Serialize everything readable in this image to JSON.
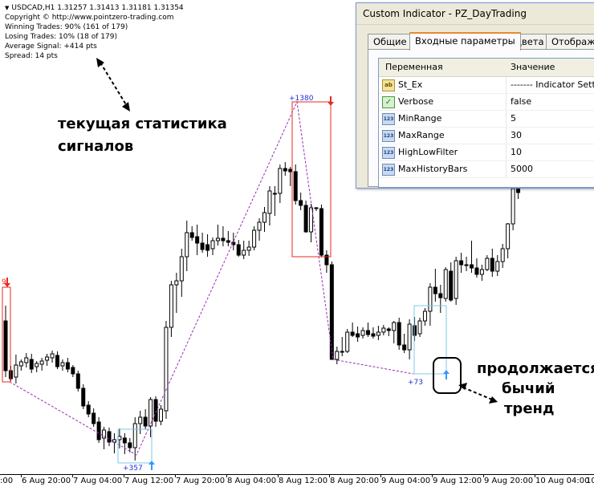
{
  "info": {
    "symbol_line": "USDCAD,H1  1.31257 1.31413 1.31181 1.31354",
    "copyright": "Copyright © http://www.pointzero-trading.com",
    "winning": "Winning Trades: 90% (161 of 179)",
    "losing": "Losing Trades: 10% (18 of 179)",
    "avg_signal": "Average Signal: +414 pts",
    "spread": "Spread: 14 pts"
  },
  "annotations": {
    "stats_line1": "текущая статистика",
    "stats_line2": "сигналов",
    "trend_line1": "продолжается",
    "trend_line2": "бычий",
    "trend_line3": "тренд"
  },
  "signals": {
    "s1": "+357",
    "s2": "+1380",
    "s3": "+73",
    "s0": "9"
  },
  "xaxis": [
    "6 Aug 20:00",
    "7 Aug 04:00",
    "7 Aug 12:00",
    "7 Aug 20:00",
    "8 Aug 04:00",
    "8 Aug 12:00",
    "8 Aug 20:00",
    "9 Aug 04:00",
    "9 Aug 12:00",
    "9 Aug 20:00",
    "10 Aug 04:00"
  ],
  "xaxis_edge_left": ":00",
  "xaxis_edge_right": "10",
  "dialog": {
    "title": "Custom Indicator - PZ_DayTrading",
    "tabs": [
      "Общие",
      "Входные параметры",
      "Цвета",
      "Отображе"
    ],
    "active_tab": "Входные параметры",
    "col_variable": "Переменная",
    "col_value": "Значение",
    "rows": [
      {
        "icon": "ab",
        "name": "St_Ex",
        "value": "------- Indicator Setti"
      },
      {
        "icon": "check",
        "name": "Verbose",
        "value": "false"
      },
      {
        "icon": "123",
        "name": "MinRange",
        "value": "5"
      },
      {
        "icon": "123",
        "name": "MaxRange",
        "value": "30"
      },
      {
        "icon": "123",
        "name": "HighLowFilter",
        "value": "10"
      },
      {
        "icon": "123",
        "name": "MaxHistoryBars",
        "value": "5000"
      }
    ]
  },
  "colors": {
    "sell": "#e8291c",
    "buy": "#3399ff",
    "signal_line": "#9b2db3",
    "candle": "#000000"
  },
  "chart_data": {
    "type": "candlestick",
    "candles": [
      [
        400,
        470,
        381,
        462
      ],
      [
        462,
        475,
        456,
        472
      ],
      [
        470,
        478,
        442,
        455
      ],
      [
        456,
        462,
        448,
        451
      ],
      [
        452,
        458,
        440,
        446
      ],
      [
        448,
        465,
        441,
        460
      ],
      [
        457,
        464,
        450,
        453
      ],
      [
        454,
        462,
        446,
        450
      ],
      [
        449,
        456,
        441,
        445
      ],
      [
        446,
        452,
        437,
        441
      ],
      [
        443,
        460,
        438,
        457
      ],
      [
        456,
        462,
        448,
        452
      ],
      [
        452,
        464,
        446,
        460
      ],
      [
        458,
        470,
        455,
        466
      ],
      [
        466,
        488,
        462,
        484
      ],
      [
        484,
        510,
        479,
        506
      ],
      [
        505,
        520,
        500,
        516
      ],
      [
        515,
        532,
        509,
        528
      ],
      [
        526,
        552,
        520,
        548
      ],
      [
        546,
        560,
        532,
        536
      ],
      [
        538,
        556,
        533,
        551
      ],
      [
        551,
        565,
        540,
        548
      ],
      [
        548,
        559,
        534,
        544
      ],
      [
        546,
        566,
        540,
        552
      ],
      [
        552,
        564,
        546,
        558
      ],
      [
        558,
        574,
        520,
        528
      ],
      [
        528,
        541,
        512,
        520
      ],
      [
        520,
        535,
        510,
        531
      ],
      [
        531,
        545,
        495,
        498
      ],
      [
        498,
        532,
        494,
        525
      ],
      [
        525,
        530,
        505,
        510
      ],
      [
        512,
        522,
        400,
        408
      ],
      [
        408,
        420,
        350,
        355
      ],
      [
        355,
        390,
        340,
        350
      ],
      [
        350,
        370,
        310,
        320
      ],
      [
        320,
        338,
        275,
        290
      ],
      [
        290,
        300,
        282,
        296
      ],
      [
        295,
        318,
        280,
        303
      ],
      [
        303,
        315,
        290,
        311
      ],
      [
        305,
        320,
        292,
        312
      ],
      [
        310,
        318,
        296,
        300
      ],
      [
        300,
        306,
        280,
        297
      ],
      [
        297,
        307,
        282,
        300
      ],
      [
        300,
        307,
        288,
        302
      ],
      [
        302,
        312,
        290,
        305
      ],
      [
        305,
        320,
        299,
        318
      ],
      [
        318,
        323,
        300,
        312
      ],
      [
        312,
        319,
        300,
        308
      ],
      [
        308,
        312,
        282,
        287
      ],
      [
        287,
        300,
        272,
        277
      ],
      [
        277,
        289,
        258,
        265
      ],
      [
        266,
        281,
        232,
        238
      ],
      [
        242,
        269,
        232,
        241
      ],
      [
        241,
        253,
        205,
        210
      ],
      [
        210,
        219,
        202,
        213
      ],
      [
        211,
        232,
        208,
        214
      ],
      [
        214,
        255,
        205,
        250
      ],
      [
        250,
        262,
        240,
        256
      ],
      [
        256,
        290,
        250,
        289
      ],
      [
        289,
        302,
        254,
        259
      ],
      [
        259,
        263,
        258,
        260
      ],
      [
        260,
        320,
        255,
        318
      ],
      [
        318,
        340,
        312,
        330
      ],
      [
        330,
        448,
        326,
        448
      ],
      [
        448,
        454,
        432,
        438
      ],
      [
        438,
        444,
        420,
        438
      ],
      [
        438,
        440,
        410,
        414
      ],
      [
        414,
        420,
        402,
        418
      ],
      [
        416,
        426,
        407,
        420
      ],
      [
        418,
        422,
        408,
        412
      ],
      [
        412,
        420,
        402,
        417
      ],
      [
        416,
        422,
        408,
        419
      ],
      [
        418,
        424,
        406,
        414
      ],
      [
        414,
        418,
        405,
        409
      ],
      [
        410,
        419,
        408,
        412
      ],
      [
        412,
        428,
        400,
        402
      ],
      [
        402,
        436,
        396,
        430
      ],
      [
        430,
        440,
        416,
        436
      ],
      [
        436,
        448,
        398,
        404
      ],
      [
        406,
        425,
        395,
        418
      ],
      [
        416,
        420,
        396,
        400
      ],
      [
        400,
        406,
        384,
        388
      ],
      [
        388,
        406,
        353,
        358
      ],
      [
        358,
        376,
        335,
        366
      ],
      [
        366,
        390,
        355,
        371
      ],
      [
        372,
        376,
        333,
        336
      ],
      [
        338,
        376,
        327,
        374
      ],
      [
        372,
        380,
        320,
        325
      ],
      [
        325,
        340,
        315,
        330
      ],
      [
        330,
        338,
        320,
        330
      ],
      [
        330,
        340,
        300,
        334
      ],
      [
        334,
        346,
        322,
        342
      ],
      [
        342,
        350,
        330,
        336
      ],
      [
        336,
        338,
        318,
        322
      ],
      [
        322,
        345,
        310,
        338
      ],
      [
        338,
        344,
        318,
        326
      ],
      [
        326,
        334,
        304,
        310
      ],
      [
        310,
        322,
        278,
        279
      ],
      [
        279,
        287,
        244,
        235
      ],
      [
        235,
        248,
        222,
        240
      ]
    ],
    "signal_prices": {
      "sell_1380": 127,
      "buy_357": 572,
      "buy_73": 466
    },
    "price_scale": "pixel-mapped"
  }
}
